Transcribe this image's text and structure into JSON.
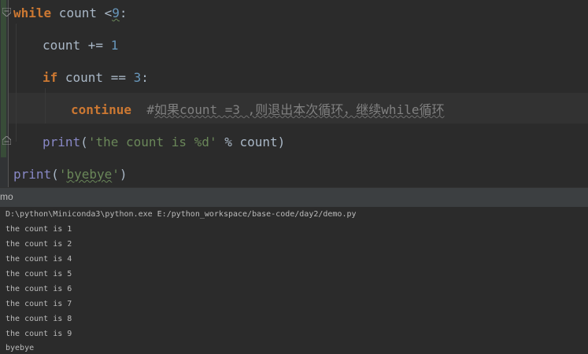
{
  "editor": {
    "line1": {
      "kw": "while",
      "var": " count ",
      "op": "<",
      "num": "9",
      "colon": ":"
    },
    "line2": {
      "var": "count += ",
      "num": "1"
    },
    "line3": {
      "kw": "if",
      "var": " count == ",
      "num": "3",
      "colon": ":"
    },
    "line4": {
      "kw": "continue",
      "comment_hash": "#",
      "comment_text": "如果count =3 ,则退出本次循环，继续while循环"
    },
    "line5": {
      "fn": "print",
      "open": "(",
      "str": "'the count is %d'",
      "rest": " % count)"
    },
    "line6": {
      "fn": "print",
      "open": "(",
      "q1": "'",
      "str": "byebye",
      "q2": "'",
      "close": ")"
    }
  },
  "run_panel": {
    "title": "mo"
  },
  "console": {
    "lines": [
      "D:\\python\\Miniconda3\\python.exe E:/python_workspace/base-code/day2/demo.py",
      "the count is 1",
      "the count is 2",
      "the count is 4",
      "the count is 5",
      "the count is 6",
      "the count is 7",
      "the count is 8",
      "the count is 9",
      "byebye"
    ]
  },
  "colors": {
    "background": "#2b2b2b",
    "keyword": "#cc7832",
    "number": "#6897bb",
    "builtin": "#8888c6",
    "string": "#6a8759",
    "comment": "#808080"
  }
}
